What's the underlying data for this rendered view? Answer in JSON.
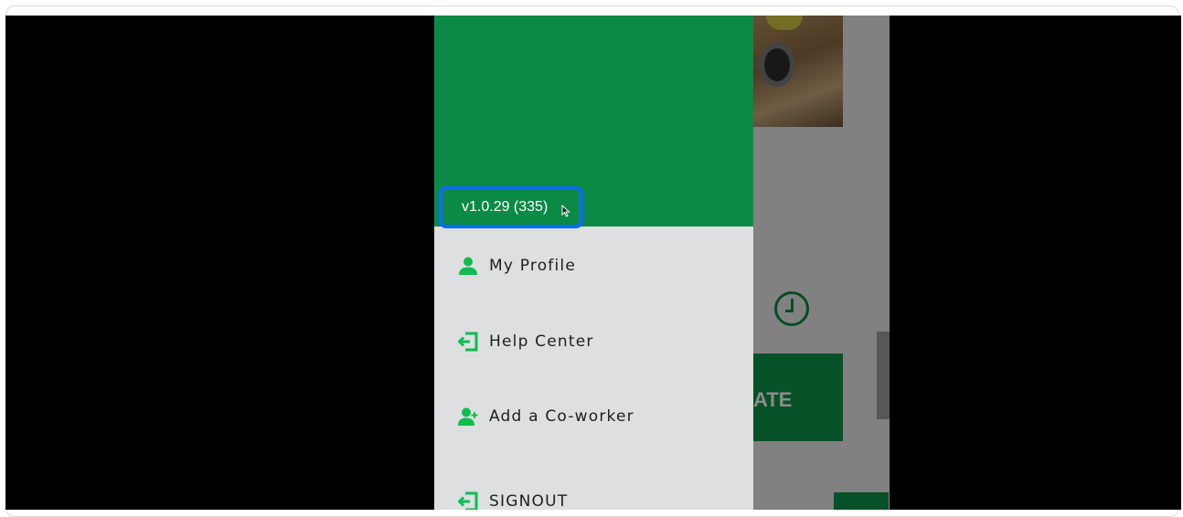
{
  "drawer": {
    "version_label": "v1.0.29 (335)",
    "items": [
      {
        "label": "My Profile",
        "icon": "person-icon"
      },
      {
        "label": "Help Center",
        "icon": "exit-icon"
      },
      {
        "label": "Add a Co-worker",
        "icon": "person-add-icon"
      },
      {
        "label": "SIGNOUT",
        "icon": "exit-icon"
      }
    ]
  },
  "background_app": {
    "button_label_fragment": "ATE"
  },
  "colors": {
    "drawer_header": "#0b8a45",
    "icon_green": "#0ebd4f",
    "highlight_border": "#0a6cf5",
    "drawer_bg": "#dedfe0"
  }
}
